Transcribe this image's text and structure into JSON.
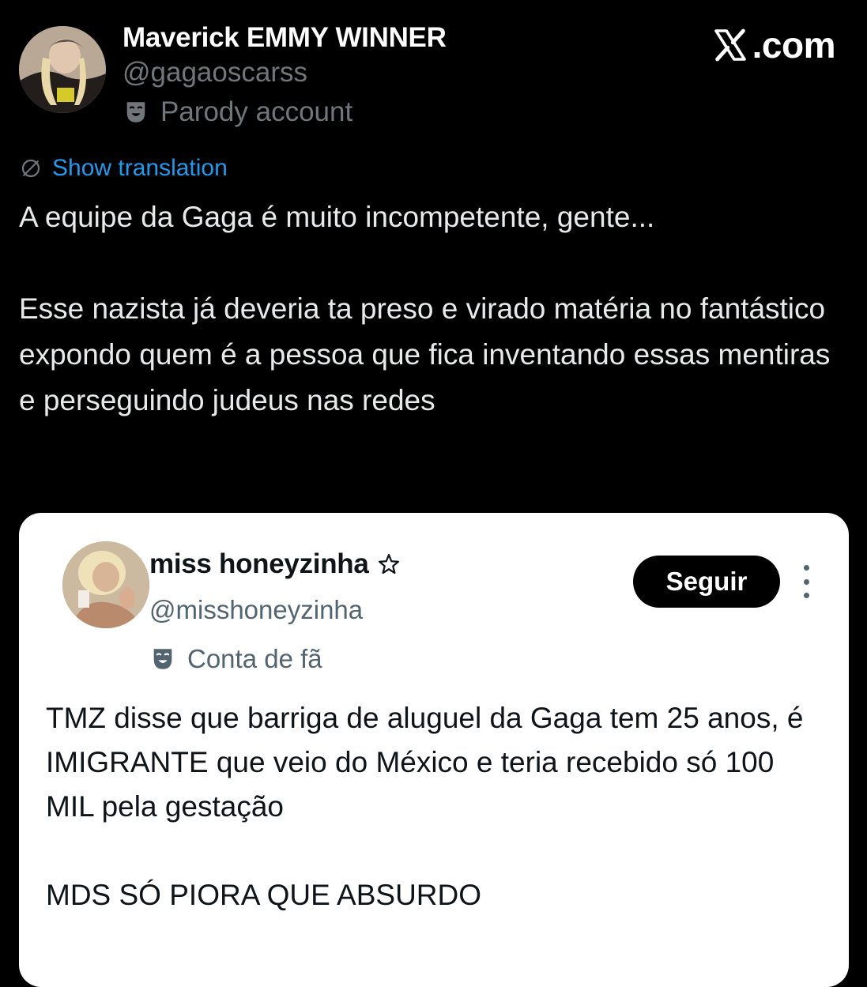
{
  "colors": {
    "background": "#000000",
    "primary_text": "#e7e9ea",
    "secondary_text": "#71767b",
    "link": "#1d9bf0",
    "card_background": "#ffffff",
    "card_text": "#0f1419",
    "card_secondary_text": "#536471"
  },
  "brand": {
    "icon": "x-logo-icon",
    "label": ".com"
  },
  "tweet": {
    "author": {
      "name": "Maverick EMMY WINNER",
      "handle": "@gagaoscarss",
      "label": "Parody account",
      "label_icon": "theater-mask-icon"
    },
    "translation_link": "Show translation",
    "translation_icon": "globe-slash-icon",
    "paragraphs": [
      "A equipe da Gaga é muito incompetente, gente...",
      "Esse nazista já deveria ta preso e virado matéria no fantástico expondo quem é a pessoa que fica inventando essas mentiras e perseguindo judeus nas redes"
    ]
  },
  "embedded_post": {
    "author": {
      "name": "miss honeyzinha",
      "name_icon": "star-outline-icon",
      "handle": "@misshoneyzinha",
      "label": "Conta de fã",
      "label_icon": "theater-mask-icon"
    },
    "follow_button": "Seguir",
    "more_icon": "more-vertical-icon",
    "paragraphs": [
      "TMZ disse que barriga de aluguel da Gaga tem 25 anos, é IMIGRANTE que veio do México e teria recebido só 100 MIL pela gestação",
      "MDS SÓ PIORA QUE ABSURDO"
    ]
  }
}
